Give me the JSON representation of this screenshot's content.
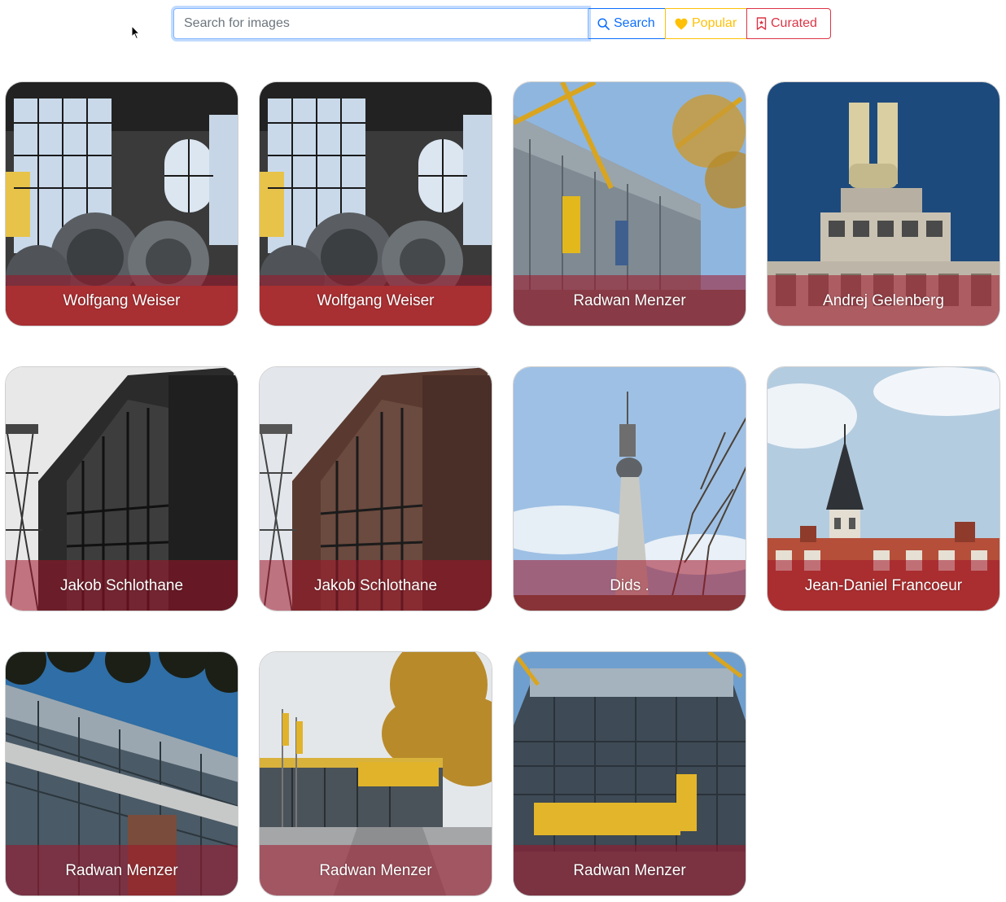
{
  "search": {
    "placeholder": "Search for images",
    "value": ""
  },
  "buttons": {
    "search_label": "Search",
    "popular_label": "Popular",
    "curated_label": "Curated"
  },
  "colors": {
    "primary": "#0d6efd",
    "warning": "#ffc107",
    "danger": "#dc3545",
    "caption_overlay": "#a01428"
  },
  "photos": [
    {
      "photographer": "Wolfgang Weiser",
      "scene": "industrial-hall"
    },
    {
      "photographer": "Wolfgang Weiser",
      "scene": "industrial-hall"
    },
    {
      "photographer": "Radwan Menzer",
      "scene": "stadium-yellow"
    },
    {
      "photographer": "Andrej Gelenberg",
      "scene": "u-tower"
    },
    {
      "photographer": "Jakob Schlothane",
      "scene": "brick-hall-bw"
    },
    {
      "photographer": "Jakob Schlothane",
      "scene": "brick-hall"
    },
    {
      "photographer": "Dids .",
      "scene": "tv-tower"
    },
    {
      "photographer": "Jean-Daniel Francoeur",
      "scene": "church-spire"
    },
    {
      "photographer": "Radwan Menzer",
      "scene": "signal-iduna"
    },
    {
      "photographer": "Radwan Menzer",
      "scene": "fanwelt"
    },
    {
      "photographer": "Radwan Menzer",
      "scene": "borusseum"
    }
  ]
}
